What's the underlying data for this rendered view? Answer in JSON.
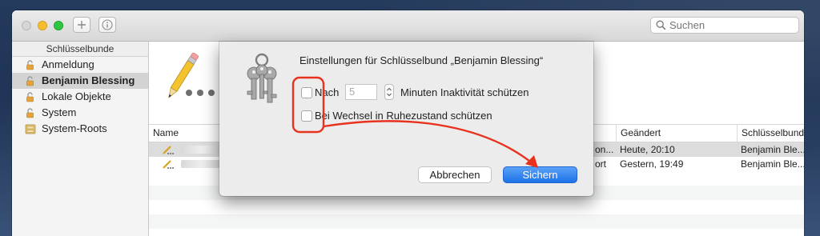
{
  "toolbar": {
    "add_icon": "plus-icon",
    "info_icon": "info-icon",
    "search_placeholder": "Suchen"
  },
  "sidebar": {
    "header": "Schlüsselbunde",
    "items": [
      {
        "label": "Anmeldung",
        "icon": "lock-open-icon"
      },
      {
        "label": "Benjamin Blessing",
        "icon": "lock-open-icon",
        "selected": true
      },
      {
        "label": "Lokale Objekte",
        "icon": "lock-open-icon"
      },
      {
        "label": "System",
        "icon": "lock-open-icon"
      },
      {
        "label": "System-Roots",
        "icon": "cabinet-icon"
      }
    ]
  },
  "list": {
    "columns": [
      "Name",
      "Geändert",
      "Schlüsselbund"
    ],
    "rows": [
      {
        "kind_fragment": "on...",
        "modified": "Heute, 20:10",
        "keychain": "Benjamin Ble..."
      },
      {
        "kind_fragment": "ort",
        "modified": "Gestern, 19:49",
        "keychain": "Benjamin Ble..."
      }
    ]
  },
  "dialog": {
    "title": "Einstellungen für Schlüsselbund „Benjamin Blessing“",
    "lock_after_label": "Nach",
    "minutes_value": "5",
    "minutes_suffix": "Minuten Inaktivität schützen",
    "lock_on_sleep_label": "Bei Wechsel in Ruhezustand schützen",
    "cancel_label": "Abbrechen",
    "save_label": "Sichern"
  },
  "colors": {
    "accent": "#1d72e8",
    "annotation": "#e8321e"
  }
}
